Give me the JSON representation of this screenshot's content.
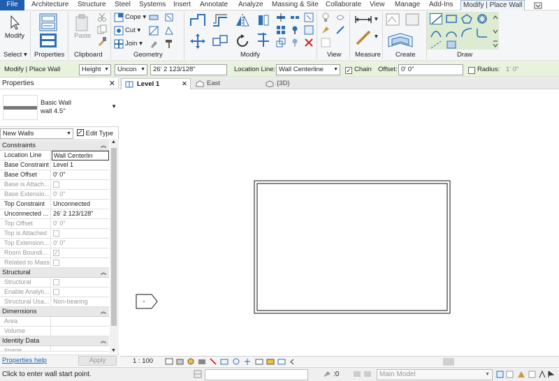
{
  "menu": {
    "file": "File",
    "tabs": [
      "Architecture",
      "Structure",
      "Steel",
      "Systems",
      "Insert",
      "Annotate",
      "Analyze",
      "Massing & Site",
      "Collaborate",
      "View",
      "Manage",
      "Add-Ins"
    ],
    "active_tab": "Modify | Place Wall"
  },
  "ribbon": {
    "modify_label": "Modify",
    "select_label": "Select",
    "properties_label": "Properties",
    "clipboard_label": "Clipboard",
    "paste_label": "Paste",
    "cope_label": "Cope",
    "cut_label": "Cut",
    "join_label": "Join",
    "geometry_label": "Geometry",
    "modify_panel_label": "Modify",
    "view_label": "View",
    "measure_label": "Measure",
    "create_label": "Create",
    "draw_label": "Draw"
  },
  "options": {
    "context": "Modify | Place Wall",
    "height_mode": "Height",
    "top_constraint": "Uncon",
    "height_value": "26'  2 123/128\"",
    "location_line_label": "Location Line:",
    "location_line_value": "Wall Centerline",
    "chain_label": "Chain",
    "chain_checked": true,
    "offset_label": "Offset:",
    "offset_value": "0'  0\"",
    "radius_label": "Radius:",
    "radius_value": "1'  0\""
  },
  "properties": {
    "title": "Properties",
    "type_family": "Basic Wall",
    "type_name": "wall 4.5\"",
    "instance_filter": "New Walls",
    "edit_type": "Edit Type",
    "groups": {
      "constraints": "Constraints",
      "structural": "Structural",
      "dimensions": "Dimensions",
      "identity": "Identity Data"
    },
    "rows": {
      "location_line": {
        "k": "Location Line",
        "v": "Wall Centerlin"
      },
      "base_constraint": {
        "k": "Base Constraint",
        "v": "Level 1"
      },
      "base_offset": {
        "k": "Base Offset",
        "v": "0'  0\""
      },
      "base_attached": {
        "k": "Base is Attach...",
        "v": ""
      },
      "base_extension": {
        "k": "Base Extensio...",
        "v": "0'  0\""
      },
      "top_constraint": {
        "k": "Top Constraint",
        "v": "Unconnected"
      },
      "unconnected": {
        "k": "Unconnected ...",
        "v": "26'  2 123/128\""
      },
      "top_offset": {
        "k": "Top Offset",
        "v": "0'  0\""
      },
      "top_attached": {
        "k": "Top is Attached",
        "v": ""
      },
      "top_extension": {
        "k": "Top Extension...",
        "v": "0'  0\""
      },
      "room_bounding": {
        "k": "Room Boundi...",
        "v": ""
      },
      "related_mass": {
        "k": "Related to Mass",
        "v": ""
      },
      "structural": {
        "k": "Structural",
        "v": ""
      },
      "enable_analytic": {
        "k": "Enable Analyti...",
        "v": ""
      },
      "structural_usage": {
        "k": "Structural Usa...",
        "v": "Non-bearing"
      },
      "area": {
        "k": "Area",
        "v": ""
      },
      "volume": {
        "k": "Volume",
        "v": ""
      },
      "image": {
        "k": "Image",
        "v": ""
      }
    },
    "help_link": "Properties help",
    "apply": "Apply"
  },
  "views": {
    "tabs": [
      {
        "label": "Level 1"
      },
      {
        "label": "East"
      },
      {
        "label": "{3D}"
      }
    ],
    "scale": "1 : 100"
  },
  "status": {
    "message": "Click to enter wall start point.",
    "coord": ":0",
    "model": "Main Model"
  },
  "colors": {
    "file_tab": "#1f5fae",
    "options_bar": "#e8f3dd",
    "icon_blue": "#2d6fb7"
  }
}
